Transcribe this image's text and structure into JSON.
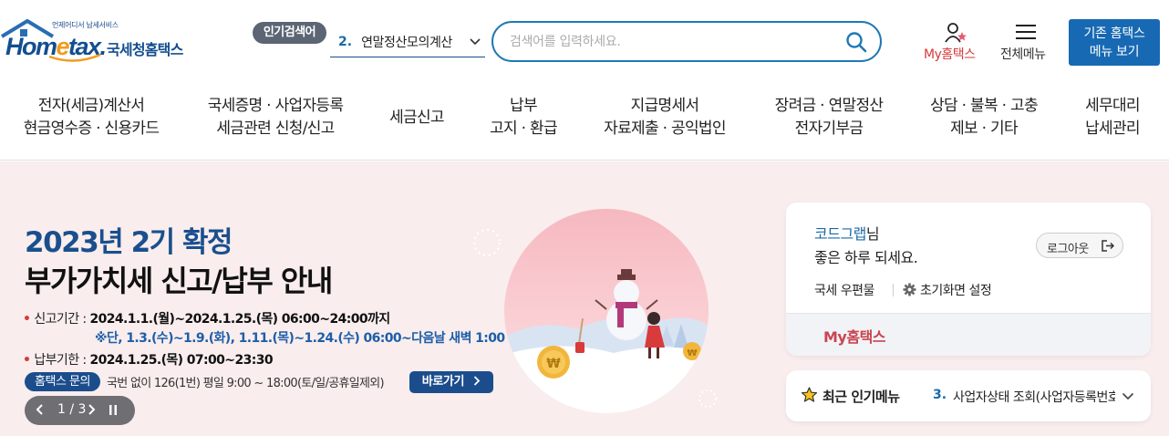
{
  "logo": {
    "small_text": "언제어디서 납세서비스",
    "word_pre": "Hom",
    "word_e": "e",
    "word_post": "tax.",
    "korean": "국세청홈택스",
    "brand_color": "#134e8f"
  },
  "popular_search": {
    "badge": "인기검색어",
    "number": "2.",
    "text": "연말정산모의계산"
  },
  "search": {
    "placeholder": "검색어를 입력하세요.",
    "icon": "search-icon"
  },
  "header_util": {
    "my_hometax": "My홈택스",
    "all_menu": "전체메뉴",
    "old_menu_line1": "기존 홈택스",
    "old_menu_line2": "메뉴 보기"
  },
  "gnb": [
    {
      "line1": "전자(세금)계산서",
      "line2": "현금영수증 · 신용카드"
    },
    {
      "line1": "국세증명 · 사업자등록",
      "line2": "세금관련 신청/신고"
    },
    {
      "line1": "세금신고",
      "line2": ""
    },
    {
      "line1": "납부",
      "line2": "고지 · 환급"
    },
    {
      "line1": "지급명세서",
      "line2": "자료제출 · 공익법인"
    },
    {
      "line1": "장려금 · 연말정산",
      "line2": "전자기부금"
    },
    {
      "line1": "상담 · 불복 · 고충",
      "line2": "제보 · 기타"
    },
    {
      "line1": "세무대리",
      "line2": "납세관리"
    }
  ],
  "banner": {
    "title1": "2023년 2기 확정",
    "title2": "부가가치세 신고/납부 안내",
    "period_label": "신고기간 :",
    "period_value": "2024.1.1.(월)~2024.1.25.(목) 06:00~24:00까지",
    "period_note": "※단, 1.3.(수)~1.9.(화), 1.11.(목)~1.24.(수) 06:00~다음날 새벽 1:00",
    "due_label": "납부기한 :",
    "due_value": "2024.1.25.(목) 07:00~23:30",
    "inquiry_badge": "홈택스 문의",
    "inquiry_text": "국번 없이 126(1번) 평일 9:00 ~ 18:00(토/일/공휴일제외)",
    "go_button": "바로가기",
    "pager": "1 / 3",
    "accent_color": "#1b4d8c"
  },
  "user": {
    "name": "코드그랩",
    "suffix": "님",
    "greeting": "좋은 하루 되세요.",
    "logout": "로그아웃",
    "post_office": "국세 우편물",
    "home_setting": "초기화면 설정",
    "my_hometax": "My홈택스"
  },
  "recent": {
    "title": "최근 인기메뉴",
    "number": "3.",
    "text": "사업자상태 조회(사업자등록번호)"
  }
}
